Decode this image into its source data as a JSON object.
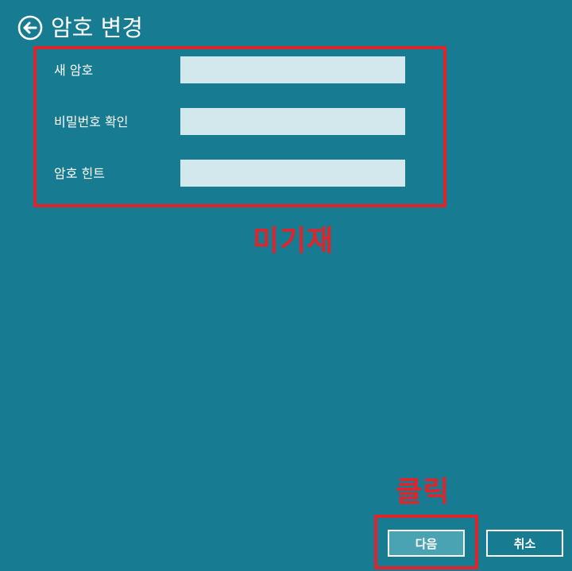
{
  "header": {
    "title": "암호 변경",
    "back_icon": "arrow-left-circle-icon"
  },
  "form": {
    "fields": [
      {
        "label": "새 암호",
        "value": ""
      },
      {
        "label": "비밀번호 확인",
        "value": ""
      },
      {
        "label": "암호 힌트",
        "value": ""
      }
    ]
  },
  "annotations": {
    "fields_note": "미기재",
    "button_note": "클릭",
    "color": "#e0242b"
  },
  "footer": {
    "next_label": "다음",
    "cancel_label": "취소"
  },
  "colors": {
    "background": "#177b91",
    "input_background": "#d3e8ec",
    "next_button_fill": "#4aa3b3",
    "text": "#ffffff"
  }
}
